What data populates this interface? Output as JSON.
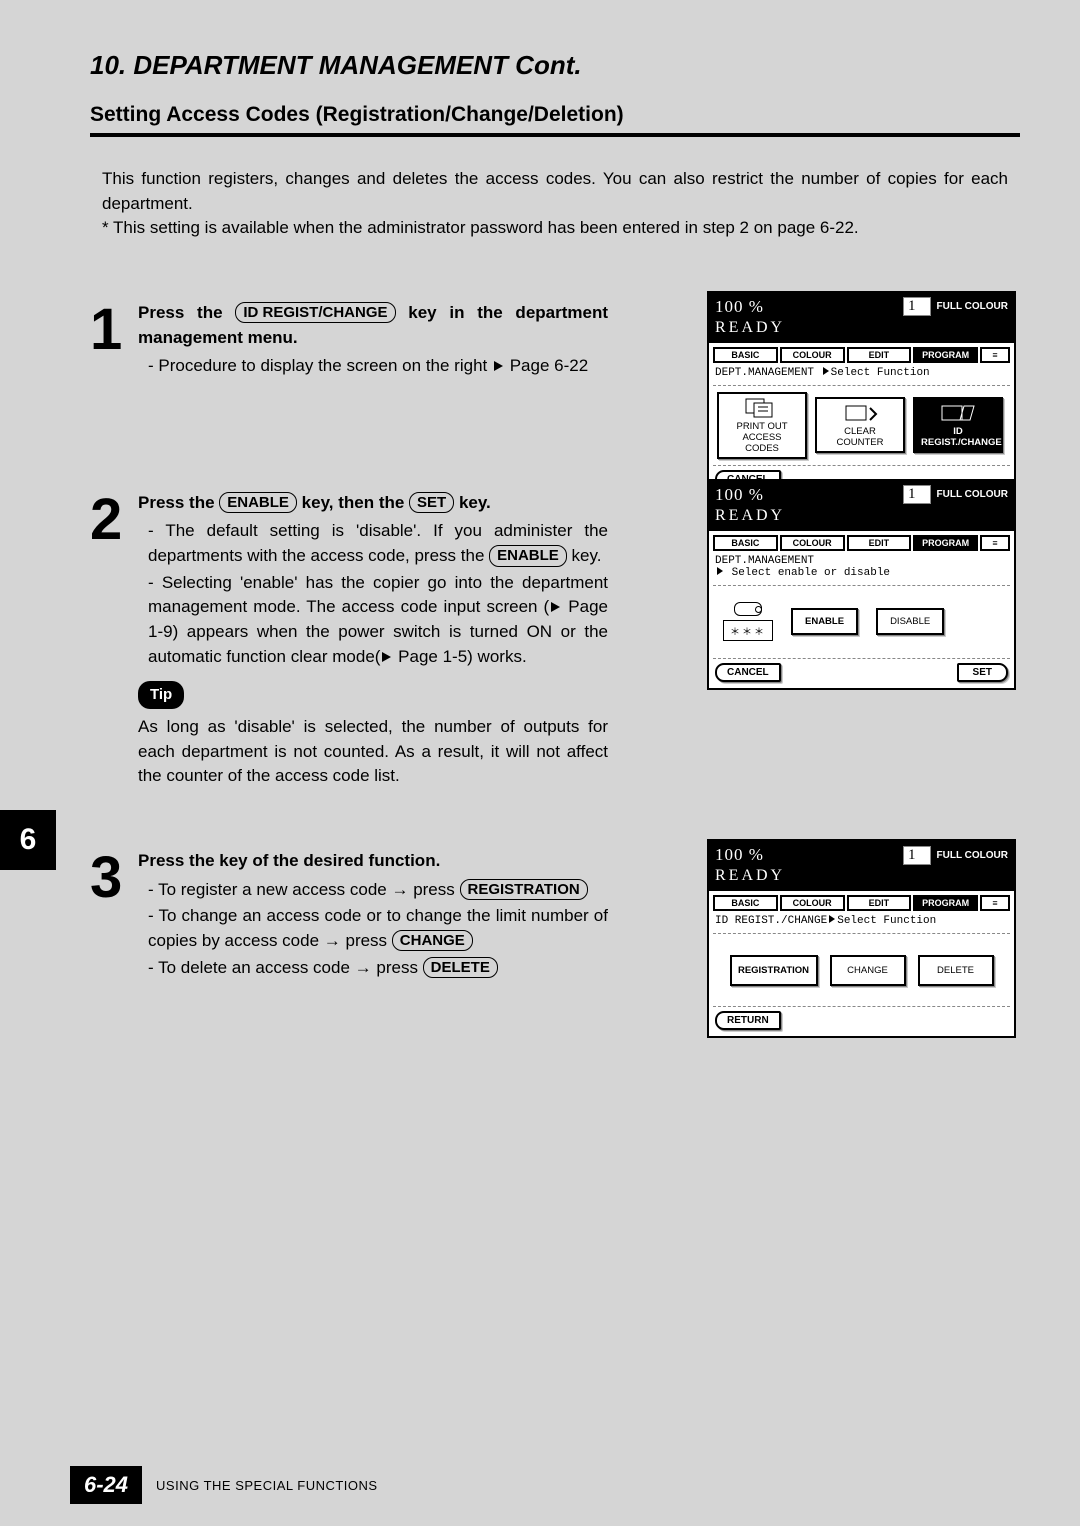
{
  "chapter_title": "10. DEPARTMENT MANAGEMENT Cont.",
  "section_title": "Setting Access Codes (Registration/Change/Deletion)",
  "intro_line1": "This function registers, changes and deletes the access codes. You can also restrict the number of copies for each department.",
  "intro_line2": "* This setting is available when the administrator password has been entered in step 2 on page 6-22.",
  "side_tab": "6",
  "footer_page": "6-24",
  "footer_text": "USING THE SPECIAL FUNCTIONS",
  "keys": {
    "id_reg": "ID REGIST/CHANGE",
    "enable": "ENABLE",
    "set": "SET",
    "registration": "REGISTRATION",
    "change": "CHANGE",
    "delete": "DELETE"
  },
  "step1": {
    "num": "1",
    "head_a": "Press the ",
    "head_b": " key in the department management menu.",
    "bullet1a": "-  Procedure to display the screen on the right ",
    "bullet1b": " Page 6-22"
  },
  "step2": {
    "num": "2",
    "head_a": "Press the ",
    "head_b": " key, then the ",
    "head_c": " key.",
    "b1a": "-  The default setting is 'disable'.  If you administer the departments with the access code, press the ",
    "b1b": " key.",
    "b2a": "-  Selecting  'enable' has the copier go into the department management mode.  The access code input screen (",
    "b2b": " Page 1-9) appears when the power switch is turned ON or the automatic function clear mode(",
    "b2c": " Page 1-5) works.",
    "tip_label": "Tip",
    "tip_text": "As long as 'disable' is selected, the number of outputs for each department is not counted.  As a result, it will not affect the counter of the access code list."
  },
  "step3": {
    "num": "3",
    "head": "Press the  key of the desired function.",
    "b1a": "- To register a new access code → press ",
    "b2a": "- To change an access code or to change the limit number of copies by access code → press ",
    "b3a": "- To delete an access code → press "
  },
  "screen_common": {
    "pct": "100 %",
    "count": "1",
    "mode": "FULL COLOUR",
    "ready": "READY",
    "tabs": {
      "basic": "BASIC",
      "colour": "COLOUR",
      "edit": "EDIT",
      "program": "PROGRAM"
    }
  },
  "screen1": {
    "crumb_a": "DEPT.MANAGEMENT",
    "crumb_b": "Select Function",
    "btn1": "PRINT OUT ACCESS CODES",
    "btn2": "CLEAR COUNTER",
    "btn3": "ID REGIST./CHANGE",
    "cancel": "CANCEL"
  },
  "screen2": {
    "crumb_a": "DEPT.MANAGEMENT",
    "crumb_b": "Select enable or disable",
    "stars": "＊＊＊",
    "enable": "ENABLE",
    "disable": "DISABLE",
    "cancel": "CANCEL",
    "set": "SET"
  },
  "screen3": {
    "crumb_a": "ID REGIST./CHANGE",
    "crumb_b": "Select Function",
    "reg": "REGISTRATION",
    "change": "CHANGE",
    "delete": "DELETE",
    "return": "RETURN"
  }
}
